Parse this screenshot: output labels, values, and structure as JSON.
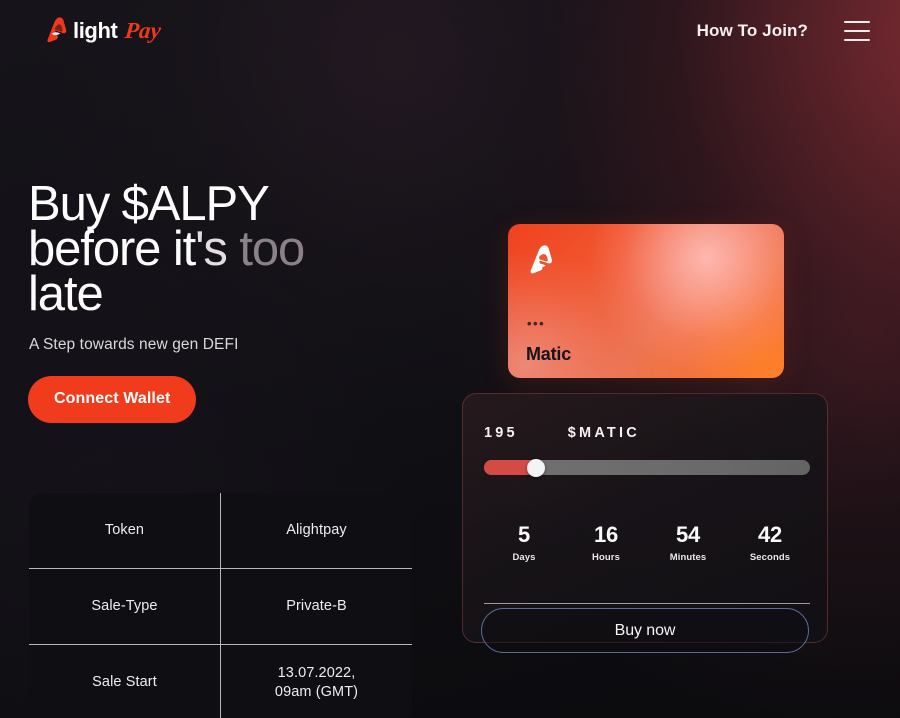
{
  "header": {
    "logo": {
      "mark_icon": "alight-a-mark-icon",
      "text_primary": "light",
      "text_accent": "Pay"
    },
    "nav_link": "How To Join?",
    "menu_icon": "hamburger-menu-icon"
  },
  "hero": {
    "headline_line1": "Buy $ALPY",
    "headline_line2_a": "before it",
    "headline_line2_b": "'s ",
    "headline_line2_c": "too",
    "headline_line3": "late",
    "subtitle": "A Step towards new gen DEFI",
    "connect_button": "Connect Wallet"
  },
  "info_table": {
    "rows": [
      {
        "label": "Token",
        "value": "Alightpay"
      },
      {
        "label": "Sale-Type",
        "value": "Private-B"
      },
      {
        "label": "Sale Start",
        "value": "13.07.2022,\n09am (GMT)"
      }
    ]
  },
  "matic_card": {
    "logo_icon": "alight-a-mark-white-icon",
    "dots": "•••",
    "name": "Matic"
  },
  "buy_panel": {
    "amount_value": "195",
    "amount_unit": "$MATIC",
    "slider_percent": 16,
    "countdown": [
      {
        "value": "5",
        "label": "Days"
      },
      {
        "value": "16",
        "label": "Hours"
      },
      {
        "value": "54",
        "label": "Minutes"
      },
      {
        "value": "42",
        "label": "Seconds"
      }
    ],
    "buy_button": "Buy now"
  },
  "colors": {
    "accent_orange": "#f03c1c",
    "card_gradient_start": "#f0411e",
    "card_gradient_end": "#f07a38",
    "slider_fill": "#d44a45",
    "buy_border": "#5b6a99",
    "table_border": "#b8b8c0"
  }
}
